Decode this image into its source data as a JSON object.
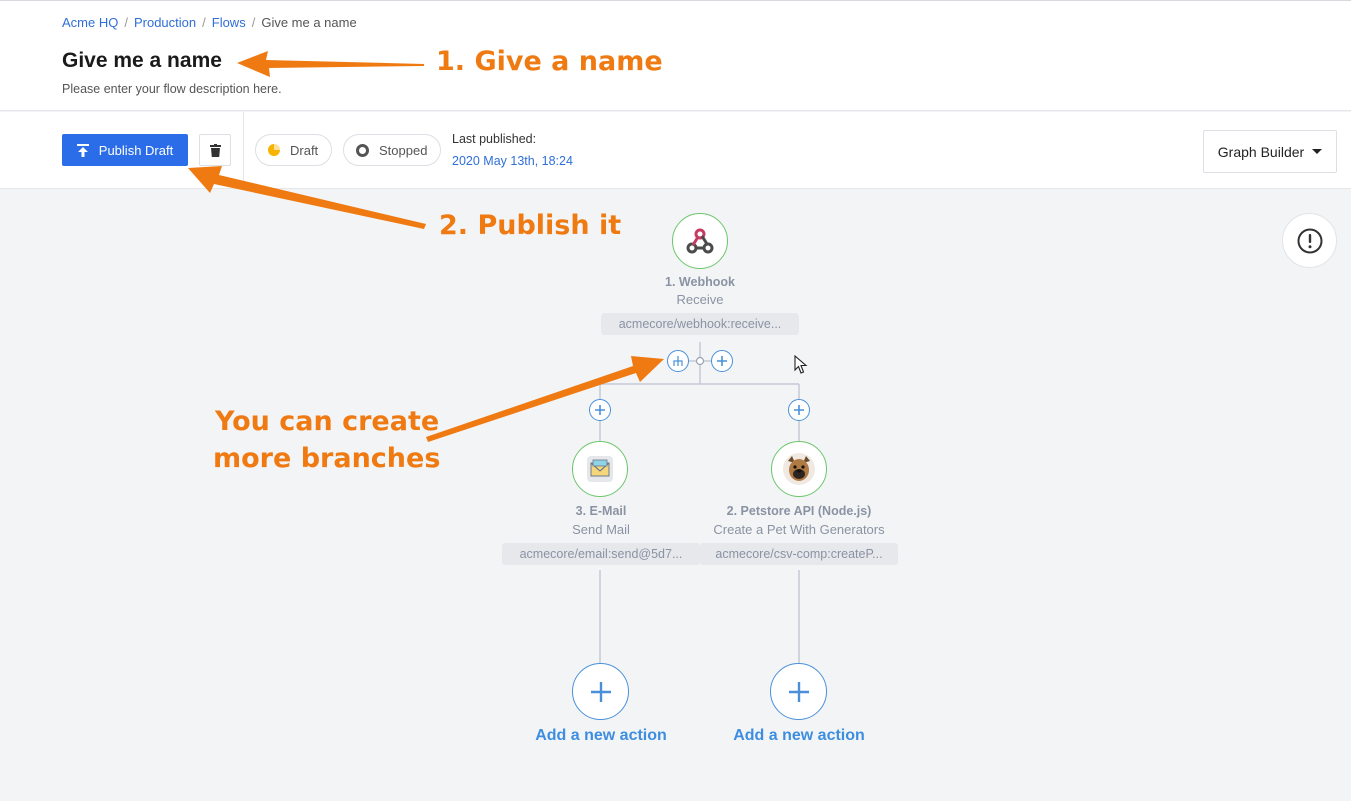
{
  "breadcrumb": {
    "items": [
      "Acme HQ",
      "Production",
      "Flows"
    ],
    "separator": "/",
    "current": "Give me a name"
  },
  "header": {
    "title": "Give me a name",
    "description": "Please enter your flow description here."
  },
  "toolbar": {
    "publish_label": "Publish Draft",
    "draft_label": "Draft",
    "stopped_label": "Stopped",
    "last_published_label": "Last published:",
    "last_published_date": "2020 May 13th, 18:24",
    "view_selector": "Graph Builder"
  },
  "nodes": {
    "webhook": {
      "title": "1. Webhook",
      "subtitle": "Receive",
      "tag": "acmecore/webhook:receive...",
      "icon": "webhook-icon"
    },
    "email": {
      "title": "3. E-Mail",
      "subtitle": "Send Mail",
      "tag": "acmecore/email:send@5d7...",
      "icon": "email-icon"
    },
    "petstore": {
      "title": "2. Petstore API (Node.js)",
      "subtitle": "Create a Pet With Generators",
      "tag": "acmecore/csv-comp:createP...",
      "icon": "dog-icon"
    }
  },
  "actions": {
    "add_left": "Add a new action",
    "add_right": "Add a new action"
  },
  "annotations": {
    "a1": "1. Give a name",
    "a2": "2. Publish it",
    "a3_line1": "You can create",
    "a3_line2": "more branches"
  },
  "colors": {
    "accent": "#2b6de8",
    "annotation": "#f07a12",
    "node_border": "#6bc66b",
    "plus_blue": "#4a90d9"
  }
}
